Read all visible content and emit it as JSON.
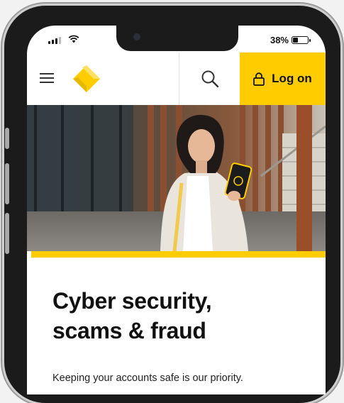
{
  "status_bar": {
    "battery_text": "38%",
    "battery_level": 0.38
  },
  "nav": {
    "menu_icon": "hamburger-icon",
    "search_icon": "search-icon",
    "logon_label": "Log on",
    "logon_icon": "padlock-icon",
    "brand_color": "#ffcc00"
  },
  "hero": {
    "image": "woman-holding-phone-photo"
  },
  "content": {
    "title_line1": "Cyber security,",
    "title_line2": "scams & fraud",
    "description": "Keeping your accounts safe is our priority."
  }
}
